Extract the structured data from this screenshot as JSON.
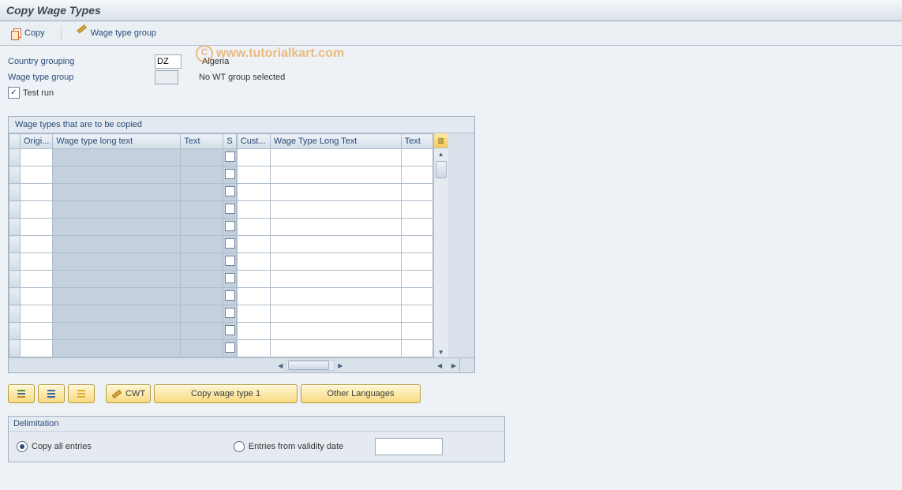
{
  "title": "Copy Wage Types",
  "watermark": "www.tutorialkart.com",
  "toolbar": {
    "copy_label": "Copy",
    "wage_type_group_label": "Wage type group"
  },
  "fields": {
    "country_grouping_label": "Country grouping",
    "country_grouping_value": "DZ",
    "country_grouping_text": "Algeria",
    "wage_type_group_label": "Wage type group",
    "wage_type_group_value": "",
    "wage_type_group_text": "No WT group selected",
    "test_run_label": "Test run",
    "test_run_checked": true
  },
  "table": {
    "title": "Wage types that are to be copied",
    "left_headers": [
      "",
      "Origi...",
      "Wage type long text",
      "Text",
      "S"
    ],
    "right_headers": [
      "Cust...",
      "Wage Type Long Text",
      "Text"
    ],
    "row_count": 12
  },
  "buttons": {
    "cwt_label": "CWT",
    "copy_wage_type_1": "Copy wage type 1",
    "other_languages": "Other Languages"
  },
  "delimitation": {
    "title": "Delimitation",
    "copy_all_label": "Copy all entries",
    "from_date_label": "Entries from validity date",
    "selected": "copy_all",
    "date_value": ""
  }
}
